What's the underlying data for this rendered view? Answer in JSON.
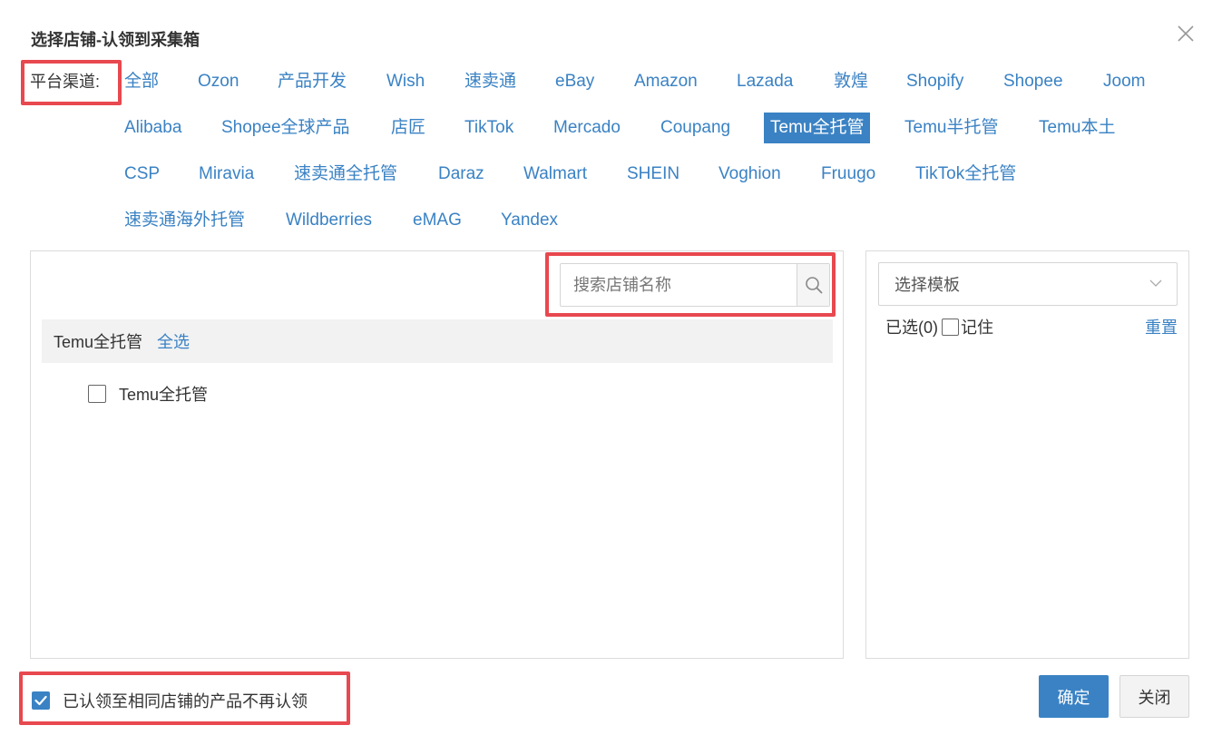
{
  "dialog": {
    "title": "选择店铺-认领到采集箱"
  },
  "platform": {
    "label": "平台渠道:",
    "items": [
      {
        "label": "全部"
      },
      {
        "label": "Ozon"
      },
      {
        "label": "产品开发"
      },
      {
        "label": "Wish"
      },
      {
        "label": "速卖通"
      },
      {
        "label": "eBay"
      },
      {
        "label": "Amazon"
      },
      {
        "label": "Lazada"
      },
      {
        "label": "敦煌"
      },
      {
        "label": "Shopify"
      },
      {
        "label": "Shopee"
      },
      {
        "label": "Joom"
      },
      {
        "label": "Alibaba"
      },
      {
        "label": "Shopee全球产品"
      },
      {
        "label": "店匠"
      },
      {
        "label": "TikTok"
      },
      {
        "label": "Mercado"
      },
      {
        "label": "Coupang"
      },
      {
        "label": "Temu全托管"
      },
      {
        "label": "Temu半托管"
      },
      {
        "label": "Temu本土"
      },
      {
        "label": "CSP"
      },
      {
        "label": "Miravia"
      },
      {
        "label": "速卖通全托管"
      },
      {
        "label": "Daraz"
      },
      {
        "label": "Walmart"
      },
      {
        "label": "SHEIN"
      },
      {
        "label": "Voghion"
      },
      {
        "label": "Fruugo"
      },
      {
        "label": "TikTok全托管"
      },
      {
        "label": "速卖通海外托管"
      },
      {
        "label": "Wildberries"
      },
      {
        "label": "eMAG"
      },
      {
        "label": "Yandex"
      }
    ],
    "active": "Temu全托管"
  },
  "shop_panel": {
    "search_placeholder": "搜索店铺名称",
    "group_name": "Temu全托管",
    "select_all": "全选",
    "shops": [
      {
        "name": "Temu全托管",
        "checked": false
      }
    ]
  },
  "template_panel": {
    "select_placeholder": "选择模板",
    "selected_label": "已选(0)",
    "remember_label": "记住",
    "reset_label": "重置"
  },
  "footer": {
    "no_repeat_label": "已认领至相同店铺的产品不再认领",
    "no_repeat_checked": true,
    "confirm_label": "确定",
    "close_label": "关闭"
  },
  "colors": {
    "accent": "#3a82c4",
    "highlight_border": "#e8484f"
  }
}
